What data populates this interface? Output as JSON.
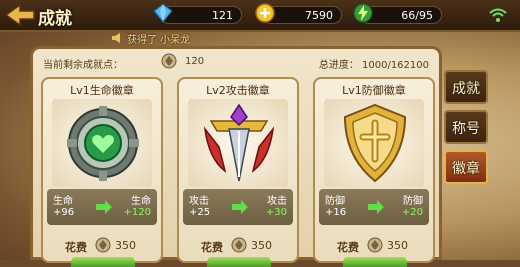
{
  "header": {
    "title": "成就",
    "diamond": "121",
    "gold": "7590",
    "energy": "66/95"
  },
  "news": {
    "text": "获得了  小呆龙"
  },
  "panel": {
    "remain_label": "当前剩余成就点：",
    "remain_value": "120",
    "progress_label": "总进度：  1000/162100"
  },
  "cards": [
    {
      "title": "Lv1生命徽章",
      "stat": "生命",
      "before": "+96",
      "after": "+120",
      "cost_label": "花费",
      "cost": "350",
      "color": "#5fb86a"
    },
    {
      "title": "Lv2攻击徽章",
      "stat": "攻击",
      "before": "+25",
      "after": "+30",
      "cost_label": "花费",
      "cost": "350",
      "color": "#d2a032"
    },
    {
      "title": "Lv1防御徽章",
      "stat": "防御",
      "before": "+16",
      "after": "+20",
      "cost_label": "花费",
      "cost": "350",
      "color": "#e0b040"
    }
  ],
  "tabs": [
    {
      "label": "成就"
    },
    {
      "label": "称号"
    },
    {
      "label": "徽章"
    }
  ]
}
